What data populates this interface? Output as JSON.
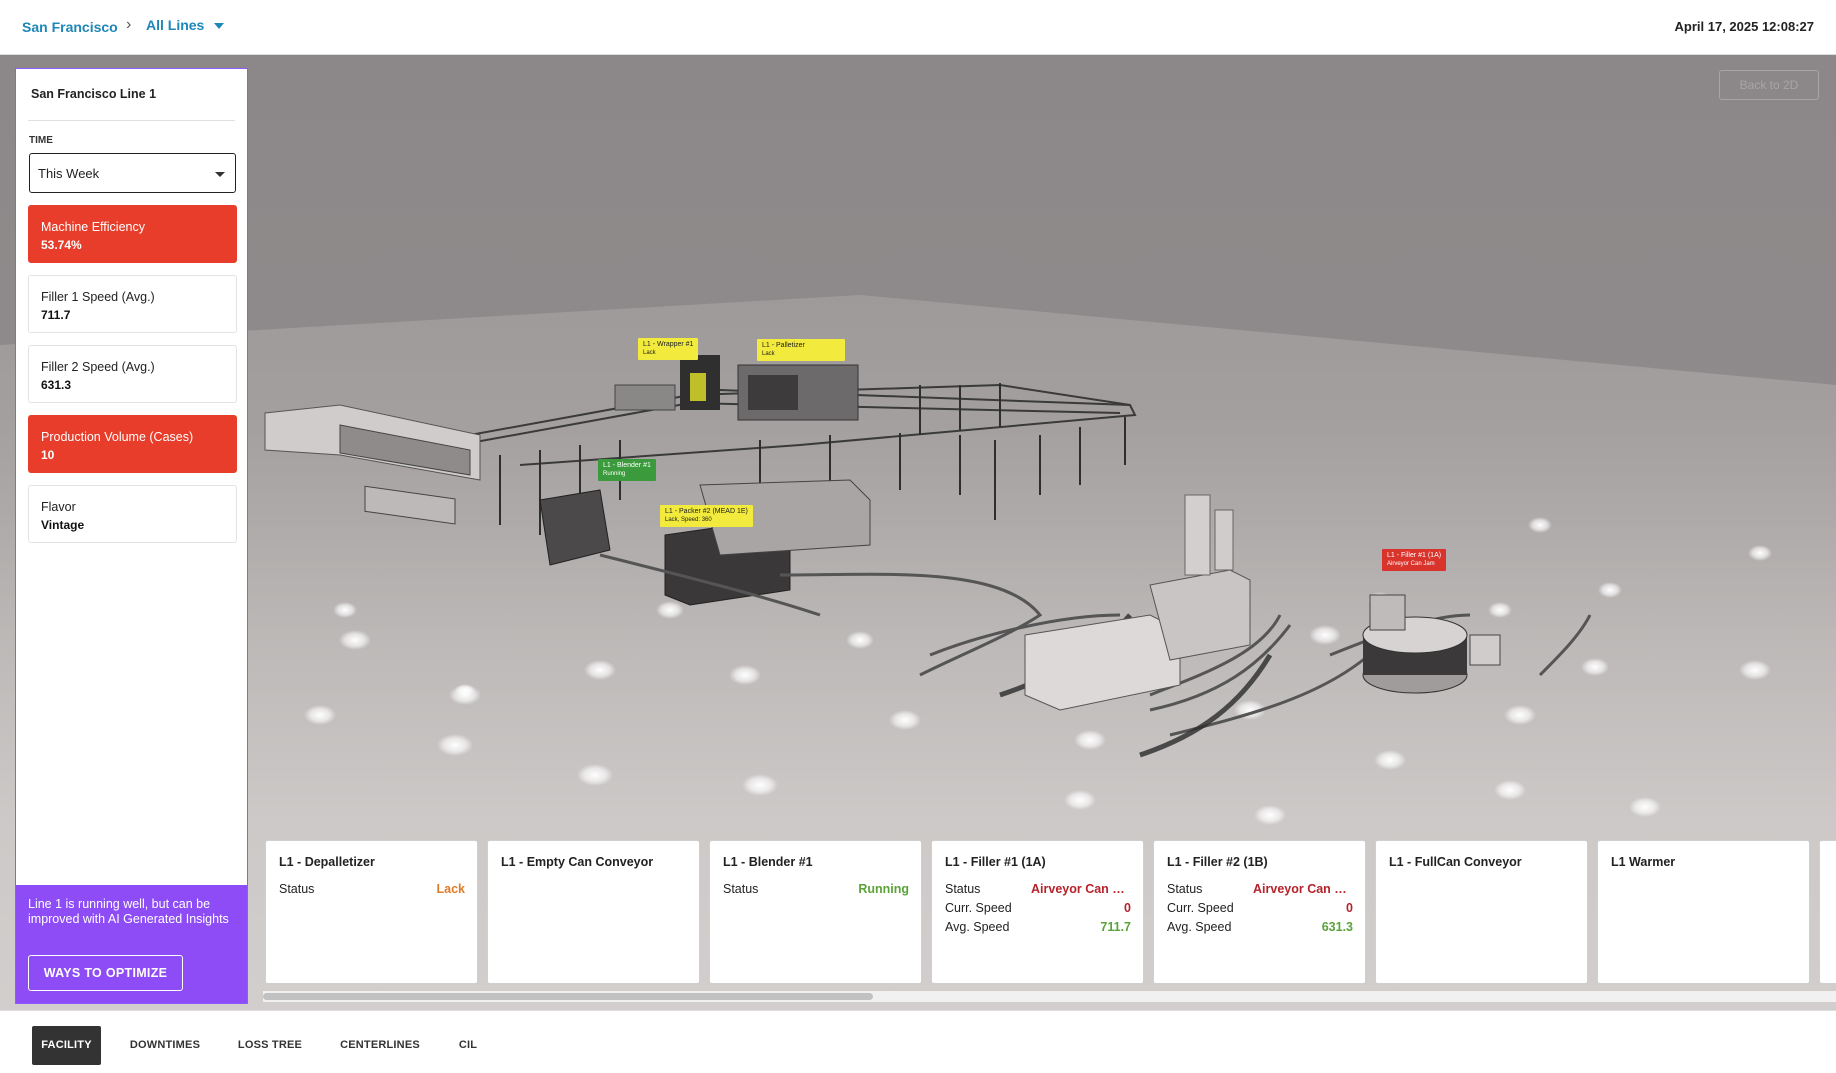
{
  "header": {
    "breadcrumb_site": "San Francisco",
    "breadcrumb_sep": "›",
    "breadcrumb_lines": "All Lines",
    "datetime": "April 17, 2025 12:08:27"
  },
  "scene": {
    "back_button": "Back to 2D",
    "labels": [
      {
        "title": "L1 - Wrapper #1",
        "status": "Lack",
        "color": "#f2ea3c"
      },
      {
        "title": "L1 - Palletizer",
        "status": "Lack",
        "color": "#f2ea3c"
      },
      {
        "title": "L1 - Blender #1",
        "status": "Running",
        "color": "#3b9a3b"
      },
      {
        "title": "L1 - Packer #2 (MEAD 1E)",
        "status": "Lack, Speed: 360",
        "color": "#f2ea3c"
      },
      {
        "title": "L1 - Filler #1 (1A)",
        "status": "Airveyor Can Jam",
        "color": "#d9342c"
      }
    ]
  },
  "left_panel": {
    "title": "San Francisco Line 1",
    "time_label": "TIME",
    "time_value": "This Week",
    "kpis": [
      {
        "label": "Machine Efficiency",
        "value": "53.74%",
        "alert": true
      },
      {
        "label": "Filler 1 Speed (Avg.)",
        "value": "711.7",
        "alert": false
      },
      {
        "label": "Filler 2 Speed (Avg.)",
        "value": "631.3",
        "alert": false
      },
      {
        "label": "Production Volume (Cases)",
        "value": "10",
        "alert": true
      },
      {
        "label": "Flavor",
        "value": "Vintage",
        "alert": false
      }
    ],
    "ai_text": "Line 1 is running well, but can be improved with AI Generated Insights",
    "ai_button": "WAYS TO OPTIMIZE"
  },
  "cards": [
    {
      "title": "L1 - Depalletizer",
      "status_label": "Status",
      "status": "Lack"
    },
    {
      "title": "L1 - Empty Can Conveyor"
    },
    {
      "title": "L1 - Blender #1",
      "status_label": "Status",
      "status": "Running"
    },
    {
      "title": "L1 - Filler #1 (1A)",
      "status_label": "Status",
      "status": "Airveyor Can Jam",
      "curr_label": "Curr. Speed",
      "curr": "0",
      "avg_label": "Avg. Speed",
      "avg": "711.7"
    },
    {
      "title": "L1 - Filler #2 (1B)",
      "status_label": "Status",
      "status": "Airveyor Can Jam",
      "curr_label": "Curr. Speed",
      "curr": "0",
      "avg_label": "Avg. Speed",
      "avg": "631.3"
    },
    {
      "title": "L1 - FullCan Conveyor"
    },
    {
      "title": "L1 Warmer"
    }
  ],
  "bottom_tabs": [
    {
      "label": "FACILITY",
      "active": true
    },
    {
      "label": "DOWNTIMES",
      "active": false
    },
    {
      "label": "LOSS TREE",
      "active": false
    },
    {
      "label": "CENTERLINES",
      "active": false
    },
    {
      "label": "CIL",
      "active": false
    }
  ],
  "colors": {
    "accent_purple": "#8d4cf5",
    "alert_red": "#e73d2a",
    "link_blue": "#1f86b8"
  }
}
